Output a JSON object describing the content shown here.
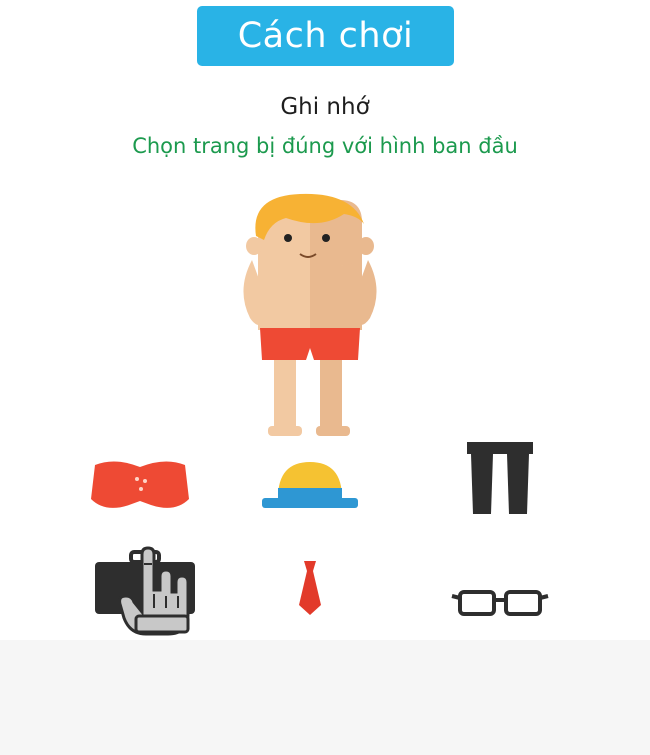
{
  "header": {
    "title": "Cách chơi"
  },
  "instructions": {
    "heading": "Ghi nhớ",
    "subheading": "Chọn trang bị đúng với hình ban đầu"
  },
  "colors": {
    "accent": "#29b3e6",
    "instruction_green": "#1c9a4e",
    "swim_shorts": "#ee4a34",
    "skin": "#f2c9a2",
    "hair": "#f7b234",
    "hat_yellow": "#f5c232",
    "hat_blue": "#2e97d3",
    "dark_item": "#2e2e2e",
    "tie_red": "#e23a2a"
  },
  "character": {
    "icon": "boy-in-swim-shorts-figure"
  },
  "items": [
    {
      "icon": "swim-shorts-icon"
    },
    {
      "icon": "bowler-hat-icon"
    },
    {
      "icon": "dark-trousers-icon"
    },
    {
      "icon": "briefcase-icon"
    },
    {
      "icon": "necktie-icon"
    },
    {
      "icon": "glasses-icon"
    }
  ],
  "tutorial": {
    "icon": "tap-hand-icon"
  }
}
